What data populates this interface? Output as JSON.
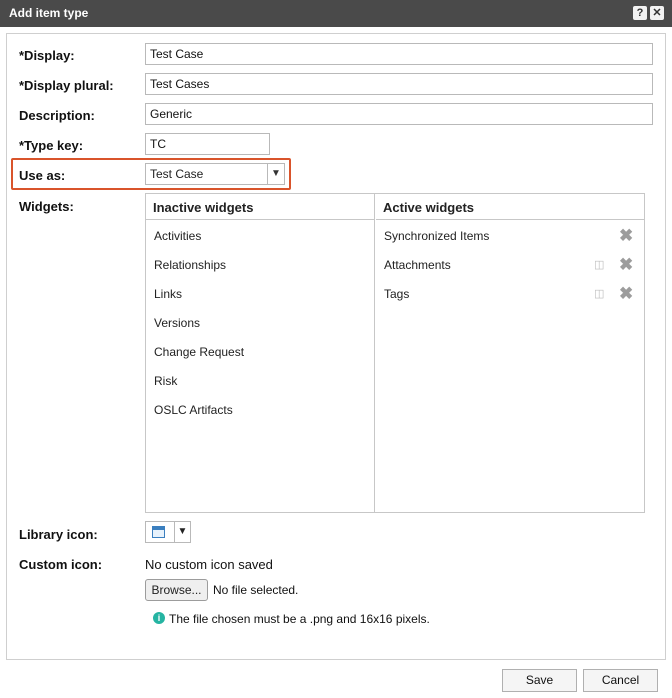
{
  "dialog": {
    "title": "Add item type",
    "help_glyph": "?",
    "close_glyph": "✕"
  },
  "form": {
    "display_label": "*Display:",
    "display_value": "Test Case",
    "display_plural_label": "*Display plural:",
    "display_plural_value": "Test Cases",
    "description_label": "Description:",
    "description_value": "Generic",
    "type_key_label": "*Type key:",
    "type_key_value": "TC",
    "use_as_label": "Use as:",
    "use_as_value": "Test Case",
    "widgets_label": "Widgets:",
    "library_icon_label": "Library icon:",
    "custom_icon_label": "Custom icon:",
    "custom_icon_status": "No custom icon saved",
    "browse_label": "Browse...",
    "file_status": "No file selected.",
    "info_text": "The file chosen must be a .png and 16x16 pixels."
  },
  "widgets": {
    "inactive_header": "Inactive widgets",
    "active_header": "Active widgets",
    "inactive": [
      "Activities",
      "Relationships",
      "Links",
      "Versions",
      "Change Request",
      "Risk",
      "OSLC Artifacts"
    ],
    "active": [
      "Synchronized Items",
      "Attachments",
      "Tags"
    ]
  },
  "footer": {
    "save_label": "Save",
    "cancel_label": "Cancel"
  },
  "colors": {
    "titlebar": "#4a4a4a",
    "highlight": "#d9542b",
    "info": "#25b4a2"
  }
}
